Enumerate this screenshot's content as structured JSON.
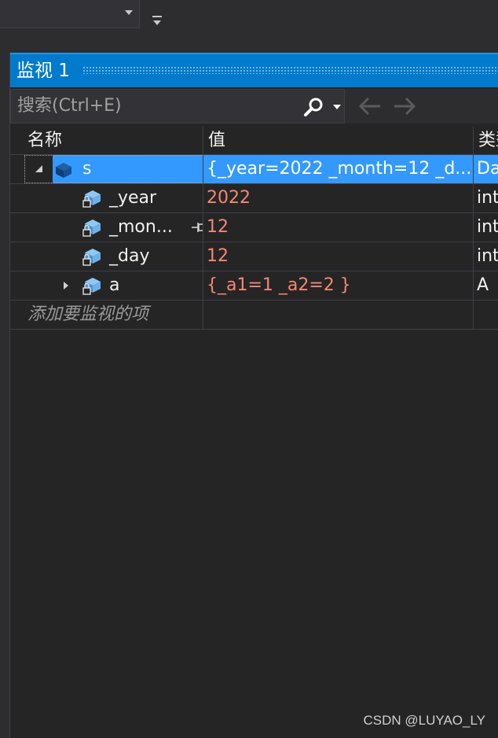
{
  "panel": {
    "title": "监视 1",
    "search_placeholder": "搜索(Ctrl+E)"
  },
  "columns": {
    "name": "名称",
    "value": "值",
    "type": "类型"
  },
  "rows": [
    {
      "name": "s",
      "value": "{_year=2022 _month=12 _d...",
      "type": "Date",
      "expander": "expanded",
      "selected": true
    },
    {
      "name": "_year",
      "value": "2022",
      "type": "int"
    },
    {
      "name": "_mon...",
      "value": "12",
      "type": "int"
    },
    {
      "name": "_day",
      "value": "12",
      "type": "int"
    },
    {
      "name": "a",
      "value": "{_a1=1 _a2=2 }",
      "type": "A",
      "expander": "collapsed"
    }
  ],
  "add_item_placeholder": "添加要监视的项",
  "icons": {
    "search": "search-icon",
    "back": "arrow-left-icon",
    "forward": "arrow-right-icon",
    "variable": "variable-icon",
    "private_field": "private-field-icon",
    "pin": "pin-icon"
  },
  "colors": {
    "accent": "#007acc",
    "selection": "#3399ff",
    "value_text": "#f48771",
    "background": "#252526"
  },
  "watermark": "CSDN @LUYAO_LY"
}
